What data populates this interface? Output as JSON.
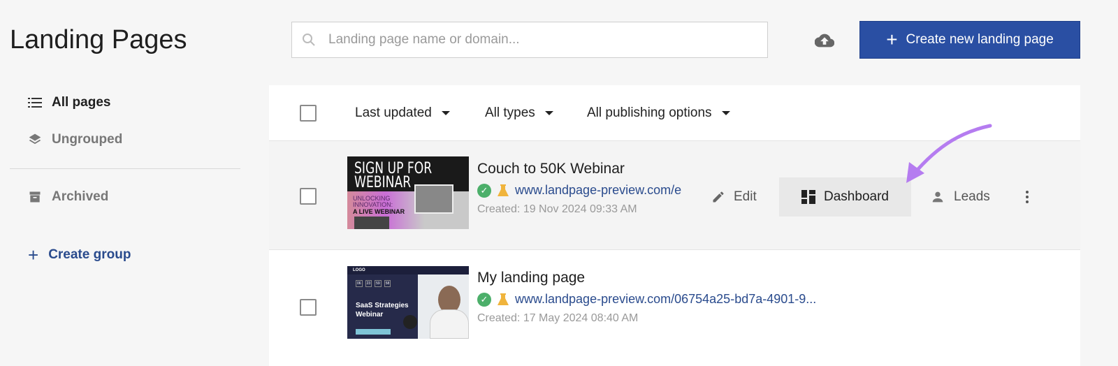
{
  "header": {
    "title": "Landing Pages",
    "search_placeholder": "Landing page name or domain...",
    "create_button": "Create new landing page",
    "upload_icon": "cloud-upload-icon"
  },
  "sidebar": {
    "items": [
      {
        "label": "All pages",
        "icon": "list-icon",
        "active": true
      },
      {
        "label": "Ungrouped",
        "icon": "layers-icon"
      },
      {
        "label": "Archived",
        "icon": "archive-icon"
      }
    ],
    "create_group": "Create group"
  },
  "filters": {
    "sort": "Last updated",
    "types": "All types",
    "publishing": "All publishing options"
  },
  "pages": [
    {
      "name": "Couch to 50K Webinar",
      "url": "www.landpage-preview.com/e",
      "created": "Created: 19 Nov 2024 09:33 AM",
      "thumb": {
        "line1": "SIGN UP FOR",
        "line2": "WEBINAR",
        "line3": "UNLOCKING INNOVATION:",
        "line4": "A LIVE WEBINAR"
      },
      "actions": {
        "edit": "Edit",
        "dashboard": "Dashboard",
        "leads": "Leads"
      }
    },
    {
      "name": "My landing page",
      "url": "www.landpage-preview.com/06754a25-bd7a-4901-9...",
      "created": "Created: 17 May 2024 08:40 AM",
      "thumb": {
        "logo": "LOGO",
        "counter": [
          "06",
          "23",
          "59",
          "58"
        ],
        "line1": "SaaS Strategies",
        "line2": "Webinar"
      }
    }
  ],
  "colors": {
    "primary": "#2a4fa3",
    "link": "#2a4b8d",
    "success": "#4caf6a",
    "test": "#f0b43c",
    "arrow": "#b57cf0"
  }
}
